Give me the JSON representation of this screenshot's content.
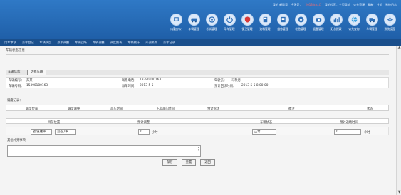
{
  "header": {
    "top_links": [
      "我的 新股设",
      "今天是：",
      "2013年xx月",
      "我的位置：主页导航",
      "公共资源",
      "刷新",
      "注销",
      "系统日志"
    ],
    "toolbar": [
      {
        "icon": "office-icon",
        "label": "内勤办公"
      },
      {
        "icon": "vehicle-icon",
        "label": "车辆管理"
      },
      {
        "icon": "dispatch-icon",
        "label": "考试管理"
      },
      {
        "icon": "power-icon",
        "label": "用车管理"
      },
      {
        "icon": "shield-icon",
        "label": "保卫管理"
      },
      {
        "icon": "fuel-icon",
        "label": "油料管理"
      },
      {
        "icon": "book-icon",
        "label": "维修管理"
      },
      {
        "icon": "tire-icon",
        "label": "轮胎管理"
      },
      {
        "icon": "camera-icon",
        "label": "设备管理"
      },
      {
        "icon": "chart-icon",
        "label": "汇总报表"
      },
      {
        "icon": "globe-icon",
        "label": "公共查询"
      },
      {
        "icon": "truck-icon",
        "label": "车辆管理"
      },
      {
        "icon": "settings-icon",
        "label": "系统设置"
      }
    ]
  },
  "navbar": [
    "用车审核",
    "派车登记",
    "车辆调度",
    "派车调整",
    "车辆回场",
    "车辆调整",
    "调度报表",
    "车辆统计",
    "未调派车",
    "派车记录"
  ],
  "page": {
    "title": "车辆状态信息",
    "vehicle_section": "车辆信息：",
    "select_vehicle_button": "选择车辆",
    "info": {
      "plate_label": "车辆编号：",
      "plate_value": "苏某",
      "phone_label": "联系电话：",
      "phone_value": "18390180163",
      "driver_label": "驾驶员：",
      "driver_value": "马秋月",
      "unit_label": "车辆号码：",
      "unit_value": "15390180163",
      "dispatch_label": "派车时间：",
      "dispatch_value": "2013-5-5",
      "return_label": "预计回场时间：",
      "return_value": "2013-5-5 8:00:00"
    },
    "history_label": "调度记录：",
    "history_columns": [
      "调度位置",
      "调度调整",
      "派车时间",
      "下次派车时间",
      "预计返场",
      "备注",
      "状态"
    ],
    "form_columns": [
      "目前位置",
      "预计调整",
      "车辆状态",
      "预计返场时间"
    ],
    "form": {
      "location_a": "省/直辖市",
      "location_b": "县/区/市",
      "hours_value": "0",
      "hours_unit": "小时",
      "status_value": "正常",
      "return_hours_value": "0",
      "return_hours_unit": "小时"
    },
    "remark_label": "其他补充事项",
    "actions": {
      "save": "保存",
      "reset": "重置",
      "back": "返回"
    }
  }
}
